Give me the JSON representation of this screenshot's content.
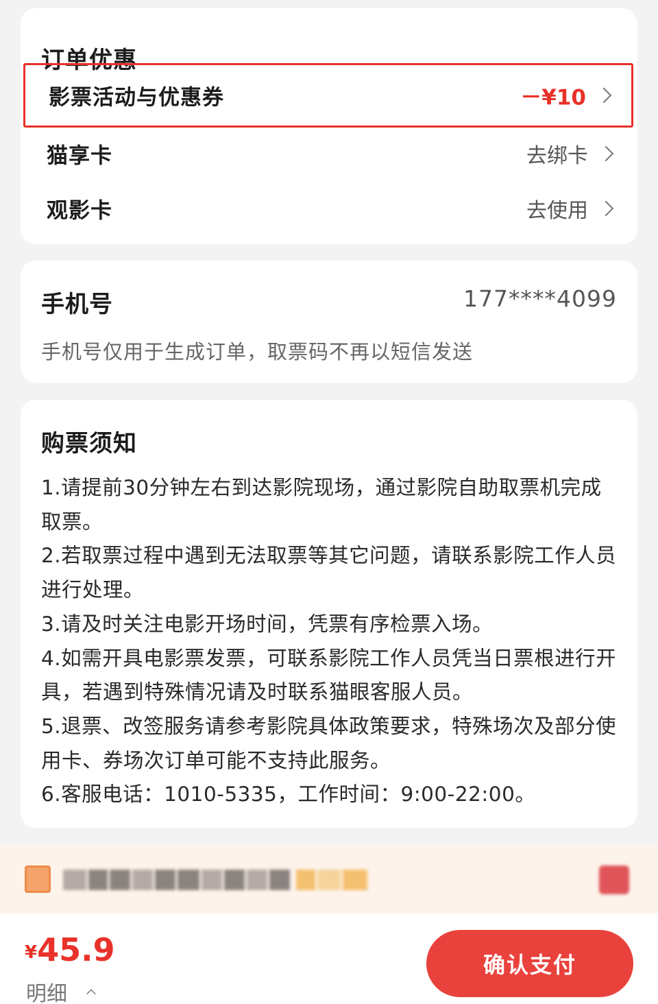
{
  "discount_card": {
    "title": "订单优惠",
    "rows": [
      {
        "label": "影票活动与优惠券",
        "value": "－¥10"
      },
      {
        "label": "猫享卡",
        "value": "去绑卡"
      },
      {
        "label": "观影卡",
        "value": "去使用"
      }
    ]
  },
  "phone_card": {
    "title": "手机号",
    "number": "177****4099",
    "note": "手机号仅用于生成订单，取票码不再以短信发送"
  },
  "notice_card": {
    "title": "购票须知",
    "body": "1.请提前30分钟左右到达影院现场，通过影院自助取票机完成取票。\n2.若取票过程中遇到无法取票等其它问题，请联系影院工作人员进行处理。\n3.请及时关注电影开场时间，凭票有序检票入场。\n4.如需开具电影票发票，可联系影院工作人员凭当日票根进行开具，若遇到特殊情况请及时联系猫眼客服人员。\n5.退票、改签服务请参考影院具体政策要求，特殊场次及部分使用卡、券场次订单可能不支持此服务。\n6.客服电话：1010-5335，工作时间：9:00-22:00。"
  },
  "bottom_bar": {
    "currency": "¥",
    "total": "45.9",
    "detail_label": "明细",
    "pay_label": "确认支付"
  },
  "icons": {
    "chevron": "chevron-right-icon",
    "detail_toggle": "chevron-up-icon",
    "promo": "coupon-icon",
    "promo_action": "gift-icon"
  },
  "colors": {
    "accent": "#e8322a",
    "pay_button": "#e9423c",
    "promo_bg": "#fdf3ea"
  }
}
